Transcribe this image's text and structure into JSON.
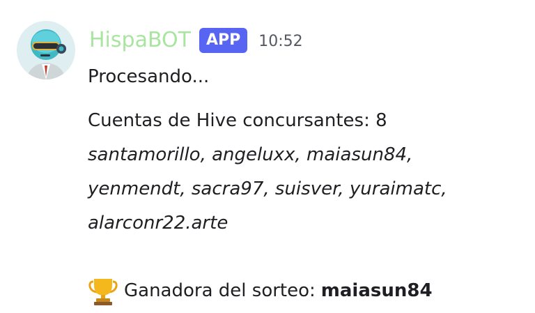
{
  "message": {
    "author": {
      "name": "HispaBOT",
      "name_color": "#a8e6a0",
      "badge": "APP",
      "badge_color": "#5865f2",
      "avatar_icon": "robot-avatar-icon"
    },
    "timestamp": "10:52",
    "status": "Procesando...",
    "count_line": "Cuentas de Hive concursantes: 8",
    "accounts": [
      "santamorillo, angeluxx, maiasun84,",
      "yenmendt, sacra97, suisver, yuraimatc,",
      "alarconr22.arte"
    ],
    "winner": {
      "icon": "trophy-icon",
      "label": "Ganadora del sorteo:",
      "name": "maiasun84"
    }
  }
}
